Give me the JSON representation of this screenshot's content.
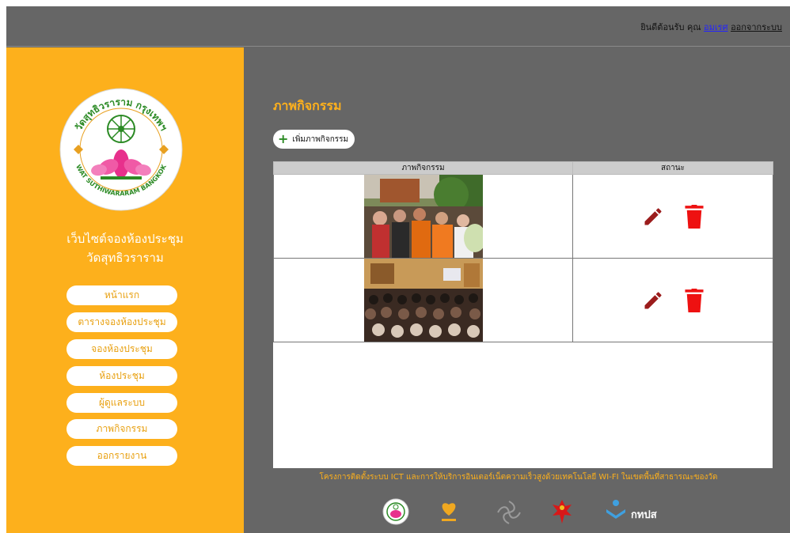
{
  "header": {
    "greeting": "ยินดีต้อนรับ คุณ",
    "username": "อมเรศ",
    "logout": "ออกจากระบบ"
  },
  "sidebar": {
    "logo_text_top": "วัดสุทธิวราราม กรุงเทพฯ",
    "logo_text_bottom": "WAT SUTHIWARARAM BANGKOK",
    "site_title_line1": "เว็บไซต์จองห้องประชุม",
    "site_title_line2": "วัดสุทธิวราราม",
    "items": [
      {
        "label": "หน้าแรก"
      },
      {
        "label": "ตารางจองห้องประชุม"
      },
      {
        "label": "จองห้องประชุม"
      },
      {
        "label": "ห้องประชุม"
      },
      {
        "label": "ผู้ดูแลระบบ"
      },
      {
        "label": "ภาพกิจกรรม"
      },
      {
        "label": "ออกรายงาน"
      }
    ]
  },
  "main": {
    "title": "ภาพกิจกรรม",
    "add_button": "เพิ่มภาพกิจกรรม",
    "table": {
      "headers": [
        "ภาพกิจกรรม",
        "สถานะ"
      ],
      "rows": [
        {
          "image": "ceremony-photo",
          "edit_icon": "pencil-icon",
          "delete_icon": "trash-icon"
        },
        {
          "image": "meeting-hall-photo",
          "edit_icon": "pencil-icon",
          "delete_icon": "trash-icon"
        }
      ]
    }
  },
  "footer": {
    "text": "โครงการติดตั้งระบบ ICT และการให้บริการอินเตอร์เน็ตความเร็วสูงด้วยเทคโนโลยี WI-FI ในเขตพื้นที่สาธารณะของวัด",
    "logos": [
      "wat-logo",
      "heart-logo",
      "emblem-logo",
      "garuda-logo",
      "tpps-logo"
    ],
    "tpps_label": "กทปส"
  },
  "colors": {
    "accent": "#fdb01c",
    "background": "#666666",
    "edit": "#9b1c1c",
    "delete": "#ee1111"
  }
}
